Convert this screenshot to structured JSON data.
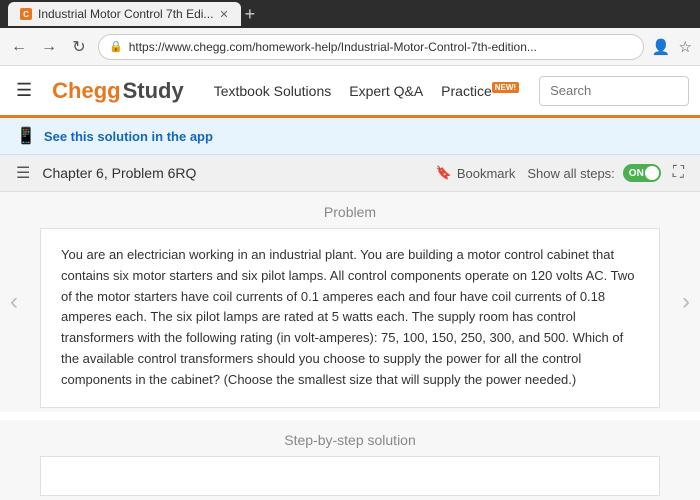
{
  "browser": {
    "tab_title": "Industrial Motor Control 7th Edi...",
    "url": "https://www.chegg.com/homework-help/Industrial-Motor-Control-7th-edition...",
    "favicon_letter": "C"
  },
  "nav": {
    "hamburger": "☰",
    "logo_chegg": "Chegg",
    "logo_study": "Study",
    "links": [
      {
        "id": "textbook-solutions",
        "label": "Textbook Solutions"
      },
      {
        "id": "expert-qa",
        "label": "Expert Q&A"
      },
      {
        "id": "practice",
        "label": "Practice",
        "badge": "NEW!"
      }
    ],
    "search_placeholder": "Search"
  },
  "app_banner": {
    "text": "See this solution in the app"
  },
  "problem_header": {
    "title": "Chapter 6, Problem 6RQ",
    "bookmark_label": "Bookmark",
    "show_steps_label": "Show all steps:",
    "toggle_state": "ON"
  },
  "problem": {
    "section_label": "Problem",
    "text": "You are an electrician working in an industrial plant. You are building a motor control cabinet that contains six motor starters and six pilot lamps. All control components operate on 120 volts AC. Two of the motor starters have coil currents of 0.1 amperes each and four have coil currents of 0.18 amperes each. The six pilot lamps are rated at 5 watts each. The supply room has control transformers with the following rating (in volt-amperes): 75, 100, 150, 250, 300, and 500. Which of the available control transformers should you choose to supply the power for all the control components in the cabinet? (Choose the smallest size that will supply the power needed.)"
  },
  "solution": {
    "section_label": "Step-by-step solution"
  }
}
